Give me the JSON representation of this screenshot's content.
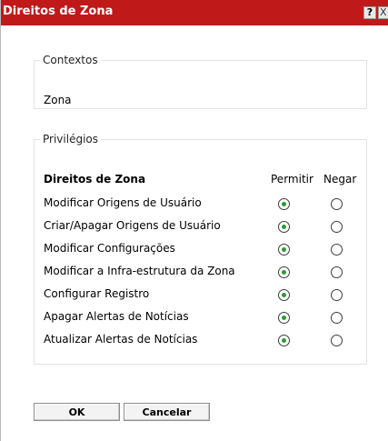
{
  "window": {
    "title": "Direitos de Zona",
    "help_glyph": "?",
    "close_glyph": "X"
  },
  "contexts": {
    "legend": "Contextos",
    "value": "Zona"
  },
  "privileges": {
    "legend": "Privilégios",
    "header": "Direitos de Zona",
    "col_permit": "Permitir",
    "col_deny": "Negar",
    "rows": [
      {
        "label": "Modificar Origens de Usuário",
        "selected": "Permitir"
      },
      {
        "label": "Criar/Apagar Origens de Usuário",
        "selected": "Permitir"
      },
      {
        "label": "Modificar Configurações",
        "selected": "Permitir"
      },
      {
        "label": "Modificar a Infra-estrutura da Zona",
        "selected": "Permitir"
      },
      {
        "label": "Configurar Registro",
        "selected": "Permitir"
      },
      {
        "label": "Apagar Alertas de Notícias",
        "selected": "Permitir"
      },
      {
        "label": "Atualizar Alertas de Notícias",
        "selected": "Permitir"
      }
    ]
  },
  "buttons": {
    "ok": "OK",
    "cancel": "Cancelar"
  },
  "colors": {
    "titlebar": "#c01919",
    "radio_selected": "#2f9a2f"
  }
}
